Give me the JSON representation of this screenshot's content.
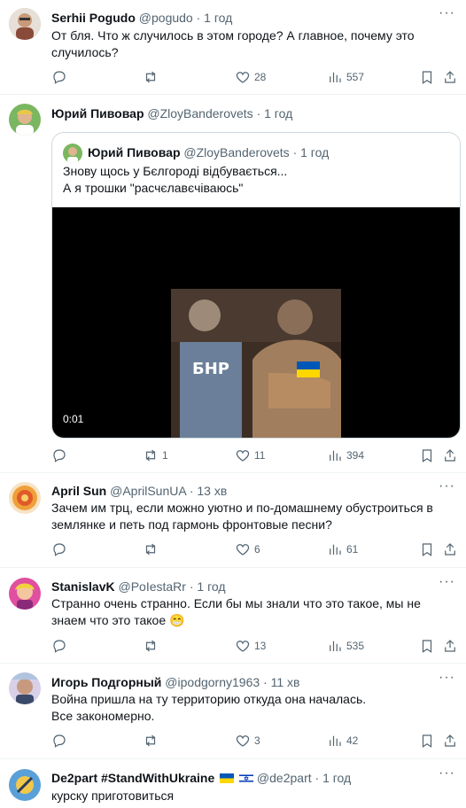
{
  "posts": [
    {
      "name": "Serhii Pogudo",
      "handle": "@pogudo",
      "time": "1 год",
      "text": "От бля. Что ж случилось в этом городе? А главное, почему это случилось?",
      "replies": "",
      "reposts": "",
      "likes": "28",
      "views": "557"
    },
    {
      "name": "Юрий Пивовар",
      "handle": "@ZloyBanderovets",
      "time": "1 год",
      "text": "",
      "replies": "",
      "reposts": "1",
      "likes": "11",
      "views": "394",
      "quote": {
        "name": "Юрий Пивовар",
        "handle": "@ZloyBanderovets",
        "time": "1 год",
        "line1": "Знову щось у Бєлгороді відбувається...",
        "line2": "А я трошки \"расчєлавєчіваюсь\"",
        "video_time": "0:01",
        "video_label": "БНР"
      }
    },
    {
      "name": "April Sun",
      "handle": "@AprilSunUA",
      "time": "13 хв",
      "text": "Зачем им трц, если можно уютно и по-домашнему обустроиться в землянке и петь под гармонь фронтовые песни?",
      "replies": "",
      "reposts": "",
      "likes": "6",
      "views": "61"
    },
    {
      "name": "StanislavK",
      "handle": "@PoIestaRr",
      "time": "1 год",
      "text": "Странно очень странно. Если бы мы знали что это такое, мы не знаем что это такое 😁",
      "replies": "",
      "reposts": "",
      "likes": "13",
      "views": "535"
    },
    {
      "name": "Игорь Подгорный",
      "handle": "@ipodgorny1963",
      "time": "11 хв",
      "text": "Война пришла на ту территорию откуда она началась.",
      "text2": "Все закономерно.",
      "replies": "",
      "reposts": "",
      "likes": "3",
      "views": "42"
    },
    {
      "name": "De2part #StandWithUkraine",
      "handle": "@de2part",
      "time": "1 год",
      "text": "курску приготовиться"
    }
  ],
  "colors": {
    "text": "#0f1419",
    "secondary": "#536471",
    "border": "#eff3f4",
    "flag_blue": "#0057b7",
    "flag_yellow": "#ffd700"
  }
}
